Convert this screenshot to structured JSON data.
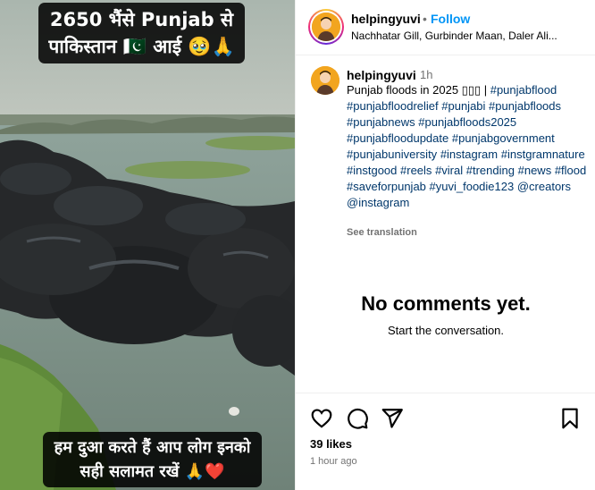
{
  "media": {
    "caption_top_line1": "2650 भैंसे Punjab से",
    "caption_top_line2": "पाकिस्तान 🇵🇰 आई 🥹🙏",
    "caption_bottom_line1": "हम दुआ करते हैं आप लोग इनको",
    "caption_bottom_line2": "सही सलामत रखें 🙏❤️"
  },
  "header": {
    "username": "helpingyuvi",
    "separator": "•",
    "follow_label": "Follow",
    "audio_text": "Nachhatar Gill, Gurbinder Maan, Daler Ali..."
  },
  "caption": {
    "username": "helpingyuvi",
    "time": "1h",
    "text_start": "Punjab floods in 2025 ▯▯▯ | ",
    "tags": [
      "#punjabflood",
      "#punjabfloodrelief",
      "#punjabi",
      "#punjabfloods",
      "#punjabnews",
      "#punjabfloods2025",
      "#punjabfloodupdate",
      "#punjabgovernment",
      "#punjabuniversity",
      "#instagram",
      "#instgramnature",
      "#instgood",
      "#reels",
      "#viral",
      "#trending",
      "#news",
      "#flood",
      "#saveforpunjab",
      "#yuvi_foodie123",
      "@creators",
      "@instagram"
    ],
    "see_translation": "See translation"
  },
  "comments": {
    "empty_title": "No comments yet.",
    "empty_subtitle": "Start the conversation."
  },
  "actions": {
    "icons": [
      "heart-icon",
      "comment-icon",
      "share-icon",
      "bookmark-icon"
    ],
    "likes": "39 likes",
    "posted": "1 hour ago"
  },
  "colors": {
    "link": "#0095f6",
    "hashtag": "#00376b",
    "muted": "#737373"
  }
}
